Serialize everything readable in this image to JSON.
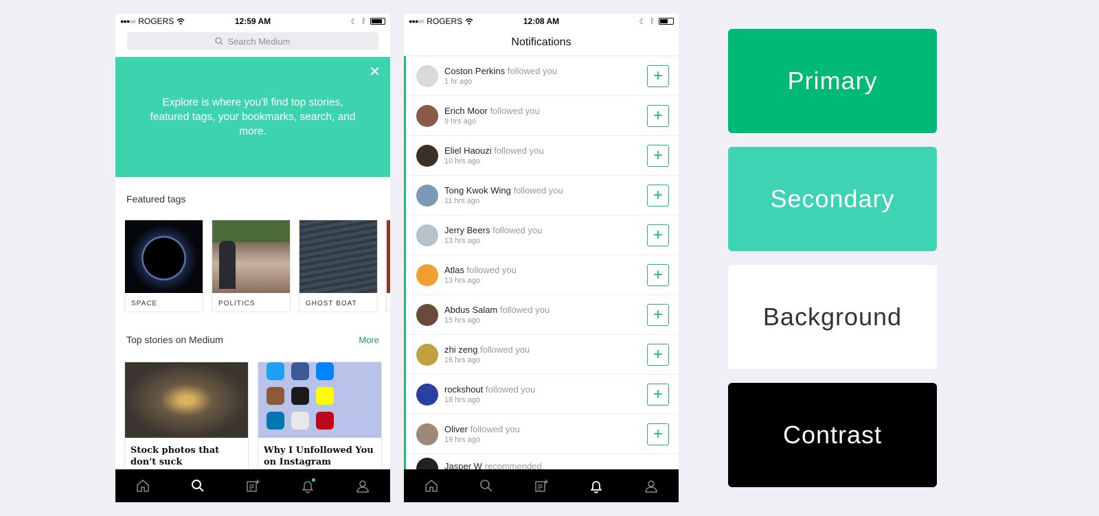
{
  "explore": {
    "status": {
      "carrier": "ROGERS",
      "time": "12:59 AM"
    },
    "search_placeholder": "Search Medium",
    "banner_text": "Explore is where you'll find top stories, featured tags, your bookmarks, search, and more.",
    "featured_title": "Featured tags",
    "tags": [
      {
        "label": "SPACE"
      },
      {
        "label": "POLITICS"
      },
      {
        "label": "GHOST BOAT"
      }
    ],
    "top_stories_title": "Top stories on Medium",
    "more_label": "More",
    "stories": [
      {
        "title": "Stock photos that don't suck"
      },
      {
        "title": "Why I Unfollowed You on Instagram"
      }
    ]
  },
  "notifications": {
    "status": {
      "carrier": "ROGERS",
      "time": "12:08 AM"
    },
    "title": "Notifications",
    "items": [
      {
        "name": "Coston Perkins",
        "action": "followed you",
        "time": "1 hr ago",
        "avatar": "#d9d9d9"
      },
      {
        "name": "Erich Moor",
        "action": "followed you",
        "time": "9 hrs ago",
        "avatar": "#8a5a4a"
      },
      {
        "name": "Eliel Haouzi",
        "action": "followed you",
        "time": "10 hrs ago",
        "avatar": "#3a3028"
      },
      {
        "name": "Tong Kwok Wing",
        "action": "followed you",
        "time": "11 hrs ago",
        "avatar": "#7a9ab8"
      },
      {
        "name": "Jerry Beers",
        "action": "followed you",
        "time": "13 hrs ago",
        "avatar": "#b8c0c8"
      },
      {
        "name": "Atlas",
        "action": "followed you",
        "time": "13 hrs ago",
        "avatar": "#f0a030"
      },
      {
        "name": "Abdus Salam",
        "action": "followed you",
        "time": "15 hrs ago",
        "avatar": "#6a4a3a"
      },
      {
        "name": "zhi zeng",
        "action": "followed you",
        "time": "16 hrs ago",
        "avatar": "#c0a040"
      },
      {
        "name": "rockshout",
        "action": "followed you",
        "time": "18 hrs ago",
        "avatar": "#2a40a0"
      },
      {
        "name": "Oliver",
        "action": "followed you",
        "time": "19 hrs ago",
        "avatar": "#a08878"
      }
    ],
    "partial_item": {
      "name": "Jasper W",
      "action": "recommended"
    }
  },
  "swatches": [
    {
      "label": "Primary",
      "color": "#00b975"
    },
    {
      "label": "Secondary",
      "color": "#3dd3b3"
    },
    {
      "label": "Background",
      "color": "#ffffff"
    },
    {
      "label": "Contrast",
      "color": "#000000"
    }
  ]
}
